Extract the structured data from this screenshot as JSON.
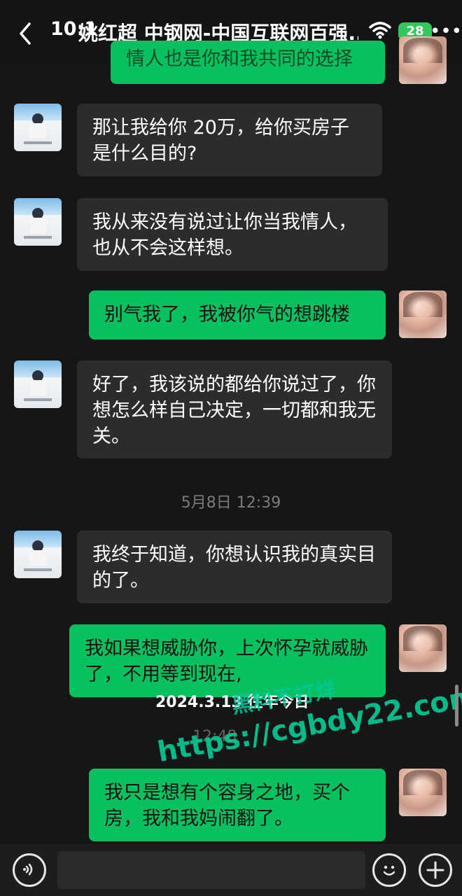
{
  "status": {
    "time": "10:1",
    "battery": "28"
  },
  "header": {
    "title": "姚红超 中钢网-中国互联网百强...",
    "more": "•••"
  },
  "messages": [
    {
      "side": "out",
      "text": "情人也是你和我共同的选择"
    },
    {
      "side": "in",
      "text": "那让我给你 20万，给你买房子是什么目的?"
    },
    {
      "side": "in",
      "text": "我从来没有说过让你当我情人，也从不会这样想。"
    },
    {
      "side": "out",
      "text": "别气我了，我被你气的想跳楼"
    },
    {
      "side": "in",
      "text": "好了，我该说的都给你说过了，你想怎么样自己决定，一切都和我无关。"
    },
    {
      "side": "in",
      "text": "我终于知道，你想认识我的真实目的了。"
    },
    {
      "side": "out",
      "text": "我如果想威胁你，上次怀孕就威胁了，不用等到现在,"
    },
    {
      "side": "out",
      "text": "我只是想有个容身之地，买个房，我和我妈闹翻了。"
    }
  ],
  "timestamps": [
    "5月8日 12:39",
    "12:48"
  ],
  "overlay": {
    "date": "2024.3.13 往年今日",
    "watermark_cn": "黑料不打烊",
    "watermark_url": "https://cgbdy22.com"
  },
  "icons": [
    "back-chevron-icon",
    "wifi-icon",
    "voice-icon",
    "emoji-icon",
    "plus-icon"
  ],
  "colors": {
    "outgoing": "#07c160",
    "incoming": "#2c2c2c",
    "background": "#161616"
  }
}
